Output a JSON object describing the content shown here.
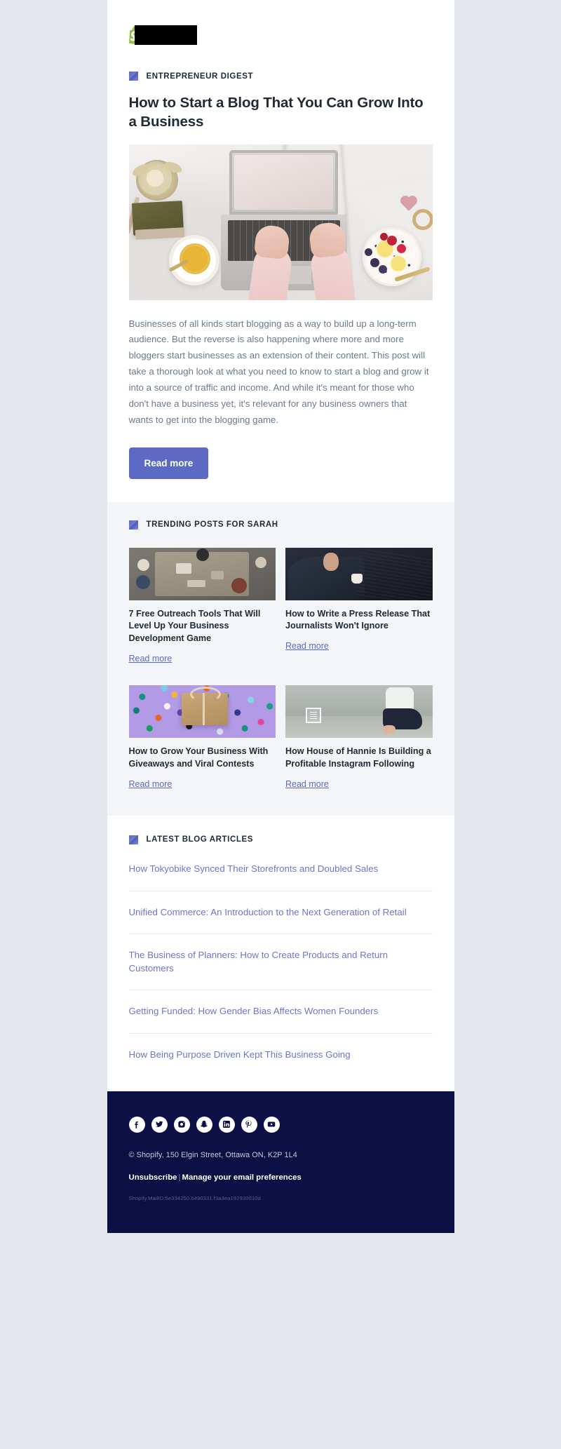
{
  "brand": {
    "logo_name": "shopify-logo",
    "logo_redacted": true,
    "accent_color": "#5c6ac4",
    "footer_bg": "#0b0f44",
    "heading_color": "#212b36",
    "body_color": "#6b7a8f",
    "link_color": "#6b77c8"
  },
  "hero": {
    "kicker": "ENTREPRENEUR DIGEST",
    "title": "How to Start a Blog That You Can Grow Into a Business",
    "image_alt": "person typing on laptop from above with tea, books and fruit plate on marble desk",
    "body": "Businesses of all kinds start blogging as a way to build up a long-term audience. But the reverse is also happening where more and more bloggers start businesses as an extension of their content. This post will take a thorough look at what you need to know to start a blog and grow it into a source of traffic and income. And while it's meant for those who don't have a business yet, it's relevant for any business owners that wants to get into the blogging game.",
    "cta_label": "Read more"
  },
  "trending": {
    "heading": "TRENDING POSTS FOR SARAH",
    "read_more_label": "Read more",
    "cards": [
      {
        "title": "7 Free Outreach Tools That Will Level Up Your Business Development Game",
        "link_label": "Read more",
        "image_alt": "overhead view of people around a meeting table"
      },
      {
        "title": "How to Write a Press Release That Journalists Won't Ignore",
        "link_label": "Read more",
        "image_alt": "man in suit reading a newspaper with a coffee cup"
      },
      {
        "title": "How to Grow Your Business With Giveaways and Viral Contests",
        "link_label": "Read more",
        "image_alt": "kraft paper gift box on purple background with confetti"
      },
      {
        "title": "How House of Hannie Is Building a Profitable Instagram Following",
        "link_label": "Read more",
        "image_alt": "woman sitting on the beach wearing a printed t-shirt"
      }
    ]
  },
  "latest": {
    "heading": "LATEST BLOG ARTICLES",
    "articles": [
      "How Tokyobike Synced Their Storefronts and Doubled Sales",
      "Unified Commerce: An Introduction to the Next Generation of Retail",
      "The Business of Planners: How to Create Products and Return Customers",
      "Getting Funded: How Gender Bias Affects Women Founders",
      "How Being Purpose Driven Kept This Business Going"
    ]
  },
  "footer": {
    "social": [
      {
        "name": "facebook-icon",
        "label": "Facebook"
      },
      {
        "name": "twitter-icon",
        "label": "Twitter"
      },
      {
        "name": "instagram-icon",
        "label": "Instagram"
      },
      {
        "name": "snapchat-icon",
        "label": "Snapchat"
      },
      {
        "name": "linkedin-icon",
        "label": "LinkedIn"
      },
      {
        "name": "pinterest-icon",
        "label": "Pinterest"
      },
      {
        "name": "youtube-icon",
        "label": "YouTube"
      }
    ],
    "address": "© Shopify,  150 Elgin Street, Ottawa ON, K2P 1L4",
    "unsubscribe_label": "Unsubscribe",
    "separator": "|",
    "preferences_label": "Manage your email preferences",
    "mail_id": "Shopify.MailID:5e334250.6490331.f3a3ea197930010d"
  }
}
